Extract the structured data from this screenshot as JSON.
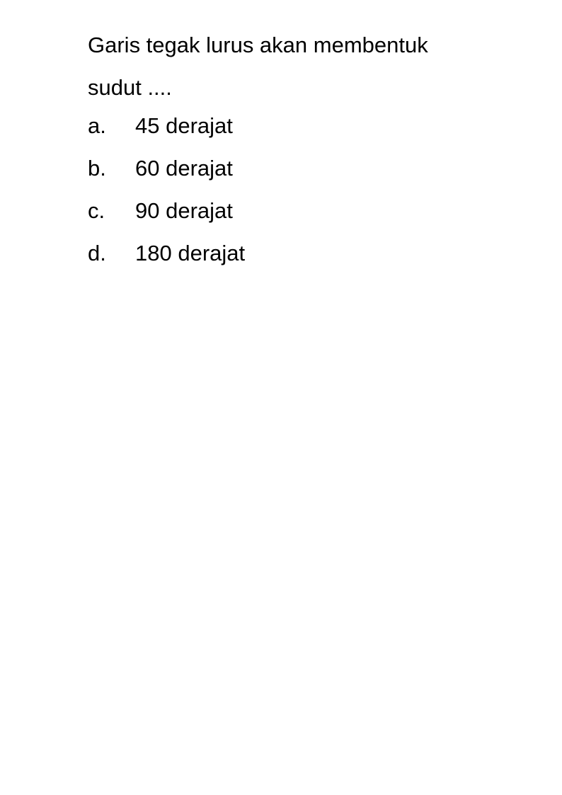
{
  "question": {
    "line1": "Garis tegak lurus akan membentuk",
    "line2": "sudut ...."
  },
  "options": [
    {
      "letter": "a.",
      "text": "45 derajat"
    },
    {
      "letter": "b.",
      "text": "60 derajat"
    },
    {
      "letter": "c.",
      "text": "90 derajat"
    },
    {
      "letter": "d.",
      "text": "180 derajat"
    }
  ]
}
